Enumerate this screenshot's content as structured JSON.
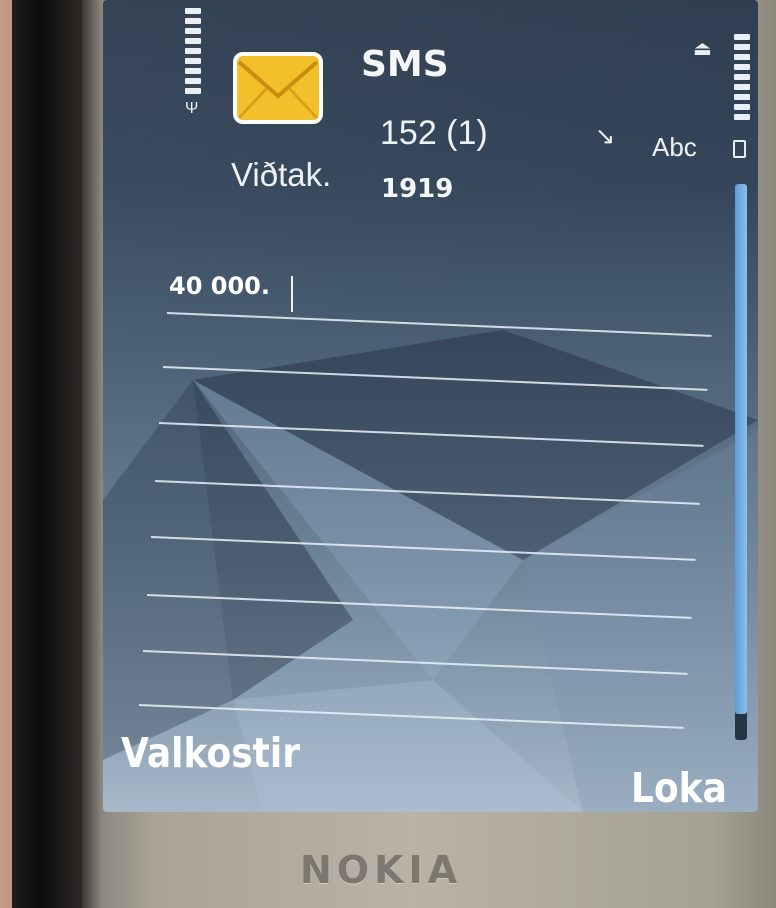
{
  "status": {
    "signal_icon": "signal-strength-icon",
    "battery_icon": "battery-level-icon",
    "upload_icon": "upload-arrow-icon"
  },
  "header": {
    "message_icon": "envelope-icon",
    "message_type": "SMS",
    "char_counter": "152 (1)",
    "text_mode_icon": "predictive-text-icon",
    "input_mode": "Abc",
    "recipient_label": "Viðtak.",
    "recipient_value": "1919"
  },
  "editor": {
    "body": "40 000."
  },
  "softkeys": {
    "left": "Valkostir",
    "right": "Loka"
  },
  "device": {
    "brand": "NOKIA"
  },
  "colors": {
    "scroll_accent": "#6aa8e0",
    "envelope": "#f1c02b"
  }
}
